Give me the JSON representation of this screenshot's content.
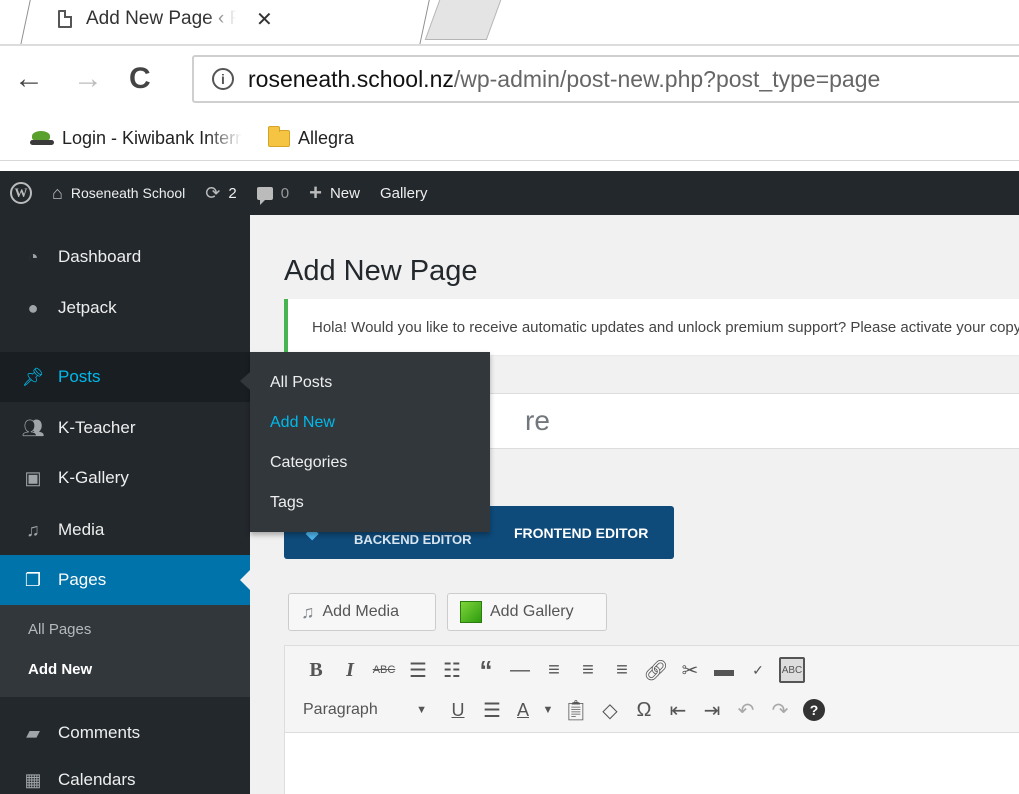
{
  "browser": {
    "tab_title": "Add New Page ‹ Roseneath School",
    "tab_close": "✕",
    "url_domain": "roseneath.school.nz",
    "url_path": "/wp-admin/post-new.php?post_type=page",
    "bookmarks": [
      {
        "label": "Login - Kiwibank Internet Banking",
        "icon": "kiwibank-icon"
      },
      {
        "label": "Allegra",
        "icon": "folder-icon"
      }
    ]
  },
  "adminbar": {
    "site_name": "Roseneath School",
    "updates_count": "2",
    "comments_count": "0",
    "new_label": "New",
    "gallery_label": "Gallery"
  },
  "menu": {
    "items": [
      {
        "label": "Dashboard",
        "icon": "dashboard-icon"
      },
      {
        "label": "Jetpack",
        "icon": "jetpack-icon"
      },
      {
        "label": "Posts",
        "icon": "pin-icon"
      },
      {
        "label": "K-Teacher",
        "icon": "people-icon"
      },
      {
        "label": "K-Gallery",
        "icon": "image-icon"
      },
      {
        "label": "Media",
        "icon": "media-icon"
      },
      {
        "label": "Pages",
        "icon": "pages-icon"
      },
      {
        "label": "Comments",
        "icon": "comment-icon"
      },
      {
        "label": "Calendars",
        "icon": "calendar-icon"
      }
    ],
    "pages_submenu": [
      "All Pages",
      "Add New"
    ],
    "posts_flyout": [
      "All Posts",
      "Add New",
      "Categories",
      "Tags"
    ]
  },
  "main": {
    "page_title": "Add New Page",
    "notice": "Hola! Would you like to receive automatic updates and unlock premium support? Please activate your copy of",
    "title_placeholder_visible": "re",
    "backend_editor": "BACKEND EDITOR",
    "frontend_editor": "FRONTEND EDITOR",
    "add_media": "Add Media",
    "add_gallery": "Add Gallery",
    "format_select": "Paragraph",
    "kbd_label": "ABC"
  },
  "colors": {
    "adminbar": "#23282d",
    "menu_active": "#0073aa",
    "menu_hover_text": "#00b9eb",
    "notice_border": "#46b450",
    "editor_switch": "#0e4b7b"
  }
}
